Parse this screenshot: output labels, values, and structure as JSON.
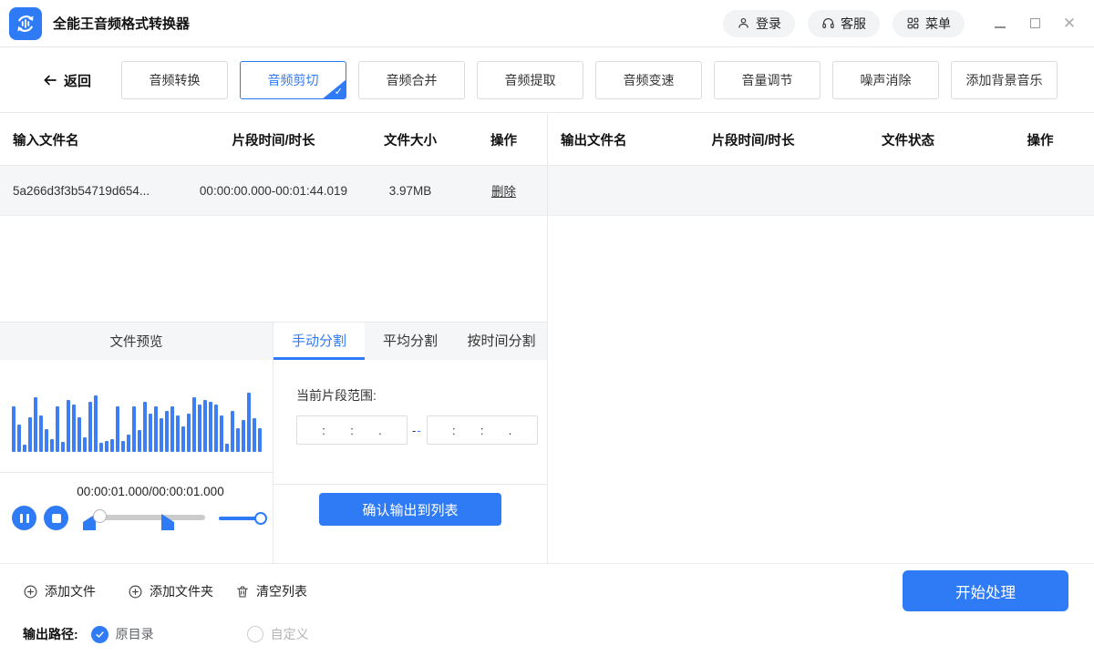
{
  "titlebar": {
    "app_title": "全能王音频格式转换器",
    "login": "登录",
    "support": "客服",
    "menu": "菜单"
  },
  "nav": {
    "back": "返回",
    "tabs": [
      {
        "label": "音频转换",
        "active": false
      },
      {
        "label": "音频剪切",
        "active": true
      },
      {
        "label": "音频合并",
        "active": false
      },
      {
        "label": "音频提取",
        "active": false
      },
      {
        "label": "音频变速",
        "active": false
      },
      {
        "label": "音量调节",
        "active": false
      },
      {
        "label": "噪声消除",
        "active": false
      },
      {
        "label": "添加背景音乐",
        "active": false
      }
    ]
  },
  "input_table": {
    "headers": [
      "输入文件名",
      "片段时间/时长",
      "文件大小",
      "操作"
    ],
    "rows": [
      {
        "name": "5a266d3f3b54719d654...",
        "time": "00:00:00.000-00:01:44.019",
        "size": "3.97MB",
        "action": "删除"
      }
    ]
  },
  "output_table": {
    "headers": [
      "输出文件名",
      "片段时间/时长",
      "文件状态",
      "操作"
    ],
    "rows": []
  },
  "preview": {
    "title": "文件预览",
    "time_display": "00:00:01.000/00:00:01.000",
    "waveform": [
      50,
      30,
      8,
      38,
      60,
      40,
      25,
      14,
      50,
      11,
      57,
      52,
      38,
      16,
      55,
      62,
      10,
      12,
      14,
      50,
      12,
      19,
      50,
      24,
      55,
      42,
      50,
      37,
      45,
      50,
      40,
      28,
      42,
      60,
      52,
      57,
      55,
      52,
      40,
      9,
      45,
      26,
      35,
      65,
      37,
      26
    ]
  },
  "split_panel": {
    "tabs": [
      "手动分割",
      "平均分割",
      "按时间分割"
    ],
    "active_tab": "手动分割",
    "range_label": "当前片段范围:",
    "time_separators": [
      ":",
      ":",
      "."
    ],
    "range_dash": "--",
    "confirm_button": "确认输出到列表"
  },
  "footer": {
    "add_file": "添加文件",
    "add_folder": "添加文件夹",
    "clear_list": "清空列表",
    "output_path_label": "输出路径:",
    "options": [
      {
        "label": "原目录",
        "selected": true
      },
      {
        "label": "自定义",
        "selected": false
      }
    ],
    "start_button": "开始处理"
  },
  "colors": {
    "primary": "#2F7BF6"
  }
}
